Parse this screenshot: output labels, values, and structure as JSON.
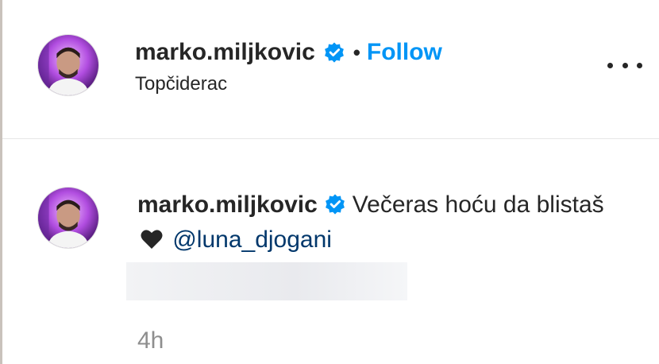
{
  "post_header": {
    "username": "marko.miljkovic",
    "separator": "•",
    "follow_label": "Follow",
    "location": "Topčiderac"
  },
  "comment": {
    "username": "marko.miljkovic",
    "text_before": "Večeras hoću da blistaš",
    "mention": "@luna_djogani",
    "timestamp": "4h"
  },
  "icons": {
    "verified": "verified-badge-icon",
    "heart": "black-heart-icon",
    "more": "more-options-icon"
  },
  "colors": {
    "follow_blue": "#0095f6",
    "mention_blue": "#00376b",
    "verified_blue": "#0095f6",
    "muted_gray": "#8e8e8e"
  }
}
